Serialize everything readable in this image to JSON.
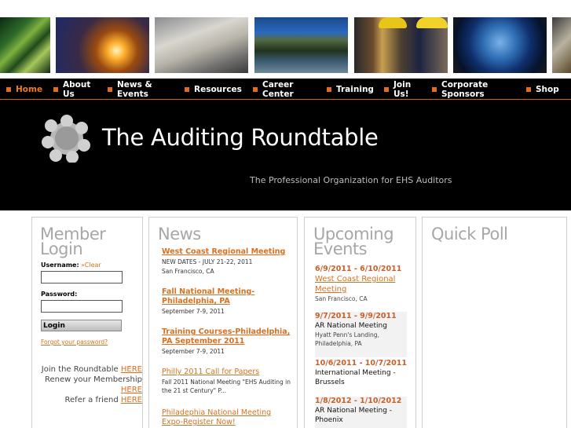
{
  "nav": {
    "items": [
      {
        "label": "Home",
        "active": true
      },
      {
        "label": "About Us"
      },
      {
        "label": "News & Events"
      },
      {
        "label": "Resources"
      },
      {
        "label": "Career Center"
      },
      {
        "label": "Training"
      },
      {
        "label": "Join Us!"
      },
      {
        "label": "Corporate Sponsors"
      },
      {
        "label": "Shop"
      }
    ]
  },
  "header": {
    "title": "The Auditing Roundtable",
    "tagline": "The Professional Organization for EHS Auditors"
  },
  "member": {
    "heading_1": "Member",
    "heading_2": "Login",
    "username_label": "Username:",
    "clear_label": "»Clear",
    "password_label": "Password:",
    "username_value": "",
    "password_value": "",
    "login_label": "Login",
    "forgot_label": "Forgot your password?",
    "join_text": "Join the Roundtable",
    "renew_text": "Renew your Membership",
    "refer_text": "Refer a friend",
    "here_label": "HERE"
  },
  "news": {
    "heading": "News",
    "items": [
      {
        "title": "West Coast Regional Meeting",
        "meta_1": "NEW DATES - JULY 21-22, 2011",
        "meta_2": "San Francisco, CA"
      },
      {
        "title": "Fall National Meeting-Philadelphia, PA",
        "meta_1": "September 7-9, 2011"
      },
      {
        "title": "Training Courses-Philadelphia, PA September 2011",
        "meta_1": "September 7-9, 2011"
      },
      {
        "title": "Philly 2011 Call for Papers",
        "meta_1": "Fall 2011 National Meeting \"EHS Auditing in the 21 st Century\" P..."
      },
      {
        "title": "Philadephia National Meeting Expo-Register Now!"
      }
    ]
  },
  "events": {
    "heading_1": "Upcoming",
    "heading_2": "Events",
    "items": [
      {
        "date": "6/9/2011 - 6/10/2011",
        "title": "West Coast Regional Meeting",
        "meta": "San Francisco, CA"
      },
      {
        "date": "9/7/2011 - 9/9/2011",
        "title": "AR National Meeting",
        "meta": "Hyatt Penn's Landing, Philadelphia, PA"
      },
      {
        "date": "10/6/2011 - 10/7/2011",
        "title": "International Meeting - Brussels"
      },
      {
        "date": "1/8/2012 - 1/10/2012",
        "title": "AR National Meeting - Phoenix"
      }
    ]
  },
  "poll": {
    "heading": "Quick Poll"
  },
  "colors": {
    "accent": "#d9701f",
    "nav_bg": "#000000",
    "panel_heading": "#a7a7a7"
  },
  "icons": {
    "nav_bullet": "orange-square-bullet",
    "logo": "roundtable-circle-logo"
  }
}
